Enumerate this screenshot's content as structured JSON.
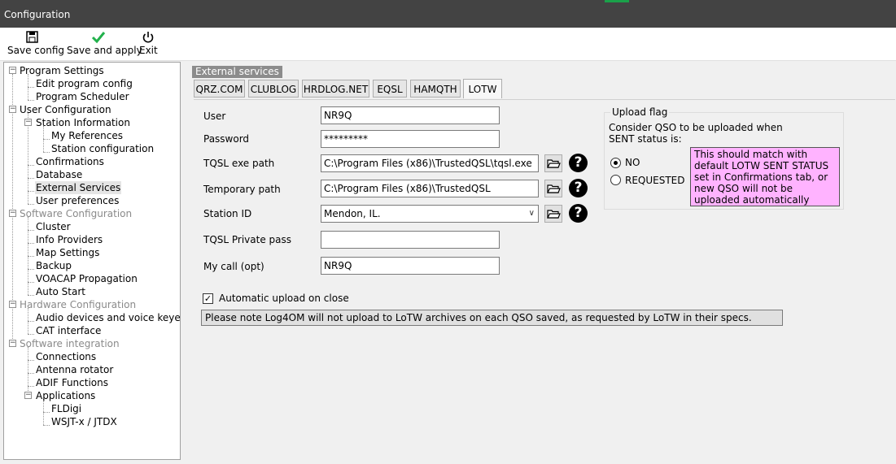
{
  "window": {
    "title": "Configuration"
  },
  "toolbar": {
    "save_config": "Save config",
    "save_apply": "Save and apply",
    "exit": "Exit"
  },
  "tree": {
    "program_settings": "Program Settings",
    "edit_program_config": "Edit program config",
    "program_scheduler": "Program Scheduler",
    "user_configuration": "User Configuration",
    "station_information": "Station Information",
    "my_references": "My References",
    "station_configuration": "Station configuration",
    "confirmations": "Confirmations",
    "database": "Database",
    "external_services": "External Services",
    "user_preferences": "User preferences",
    "software_configuration": "Software Configuration",
    "cluster": "Cluster",
    "info_providers": "Info Providers",
    "map_settings": "Map Settings",
    "backup": "Backup",
    "voacap": "VOACAP Propagation",
    "auto_start": "Auto Start",
    "hardware_configuration": "Hardware Configuration",
    "audio_devices": "Audio devices and voice keyer",
    "cat_interface": "CAT interface",
    "software_integration": "Software integration",
    "connections": "Connections",
    "antenna_rotator": "Antenna rotator",
    "adif_functions": "ADIF Functions",
    "applications": "Applications",
    "fldigi": "FLDigi",
    "wsjtx": "WSJT-x / JTDX"
  },
  "panel": {
    "group_label": "External services",
    "tabs": {
      "qrz": "QRZ.COM",
      "clublog": "CLUBLOG",
      "hrdlog": "HRDLOG.NET",
      "eqsl": "EQSL",
      "hamqth": "HAMQTH",
      "lotw": "LOTW"
    },
    "active_tab": "LOTW"
  },
  "form": {
    "user_label": "User",
    "user_value": "NR9Q",
    "password_label": "Password",
    "password_value": "*********",
    "tqsl_exe_label": "TQSL exe path",
    "tqsl_exe_value": "C:\\Program Files (x86)\\TrustedQSL\\tqsl.exe",
    "temp_path_label": "Temporary path",
    "temp_path_value": "C:\\Program Files (x86)\\TrustedQSL",
    "station_id_label": "Station ID",
    "station_id_value": "Mendon, IL.",
    "tqsl_pass_label": "TQSL Private pass",
    "tqsl_pass_value": "",
    "mycall_label": "My call (opt)",
    "mycall_value": "NR9Q",
    "auto_upload_label": "Automatic upload on close",
    "auto_upload_checked": true,
    "notice": "Please note Log4OM will not upload to LoTW archives on each QSO saved, as requested by LoTW in their specs."
  },
  "upload_flag": {
    "legend": "Upload flag",
    "line1": "Consider QSO to be uploaded when",
    "line2": "SENT status is:",
    "opt_no": "NO",
    "opt_requested": "REQUESTED",
    "selected": "NO",
    "note": "This should match with default LOTW SENT STATUS set in Confirmations tab, or new QSO will not be uploaded automatically"
  },
  "colors": {
    "titlebar": "#434343",
    "note_bg": "#ffb3ff",
    "save_apply_icon": "#22b14c"
  }
}
